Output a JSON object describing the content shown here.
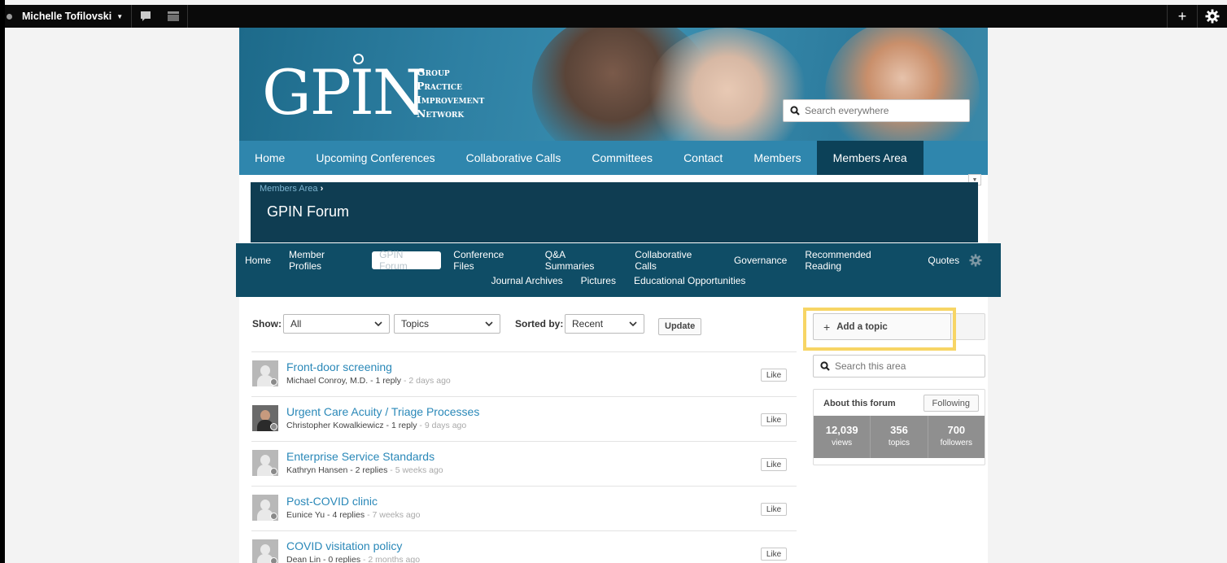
{
  "admin_bar": {
    "user_name": "Michelle Tofilovski",
    "plus_glyph": "+",
    "icons": [
      "status-dot-icon",
      "comment-icon",
      "notes-icon",
      "plus-icon",
      "gear-icon"
    ]
  },
  "banner": {
    "logo_text": "GPIN",
    "logo_tagline": [
      "Group",
      "Practice",
      "Improvement",
      "Network"
    ],
    "search_placeholder": "Search everywhere"
  },
  "main_nav": {
    "items": [
      "Home",
      "Upcoming Conferences",
      "Collaborative Calls",
      "Committees",
      "Contact",
      "Members",
      "Members Area"
    ],
    "active": "Members Area"
  },
  "forum_header": {
    "breadcrumb": "Members Area",
    "breadcrumb_sep": "›",
    "title": "GPIN Forum"
  },
  "sub_nav": {
    "row1": [
      "Home",
      "Member Profiles",
      "GPIN Forum",
      "Conference Files",
      "Q&A Summaries",
      "Collaborative Calls",
      "Governance",
      "Recommended Reading",
      "Quotes"
    ],
    "row2": [
      "Journal Archives",
      "Pictures",
      "Educational Opportunities"
    ],
    "active": "GPIN Forum"
  },
  "filters": {
    "show_label": "Show:",
    "show_value": "All",
    "type_value": "Topics",
    "sorted_label": "Sorted by:",
    "sorted_value": "Recent",
    "update_label": "Update"
  },
  "topics": [
    {
      "title": "Front-door screening",
      "author": "Michael Conroy, M.D.",
      "replies": "1 reply",
      "age": "2 days ago",
      "like": "Like",
      "avatar": "default"
    },
    {
      "title": "Urgent Care Acuity / Triage Processes",
      "author": "Christopher Kowalkiewicz",
      "replies": "1 reply",
      "age": "9 days ago",
      "like": "Like",
      "avatar": "photo"
    },
    {
      "title": "Enterprise Service Standards",
      "author": "Kathryn Hansen",
      "replies": "2 replies",
      "age": "5 weeks ago",
      "like": "Like",
      "avatar": "default"
    },
    {
      "title": "Post-COVID clinic",
      "author": "Eunice Yu",
      "replies": "4 replies",
      "age": "7 weeks ago",
      "like": "Like",
      "avatar": "default"
    },
    {
      "title": "COVID visitation policy",
      "author": "Dean Lin",
      "replies": "0 replies",
      "age": "2 months ago",
      "like": "Like",
      "avatar": "default"
    }
  ],
  "sidebar": {
    "add_topic_label": "Add a topic",
    "add_topic_glyph": "+",
    "search_placeholder": "Search this area",
    "about_title": "About this forum",
    "following_label": "Following",
    "stats": [
      {
        "value": "12,039",
        "label": "views"
      },
      {
        "value": "356",
        "label": "topics"
      },
      {
        "value": "700",
        "label": "followers"
      }
    ]
  },
  "colors": {
    "highlight": "#f7d565",
    "main_nav": "#2f86ad",
    "active_nav": "#0c4158",
    "link": "#2a88b8"
  }
}
